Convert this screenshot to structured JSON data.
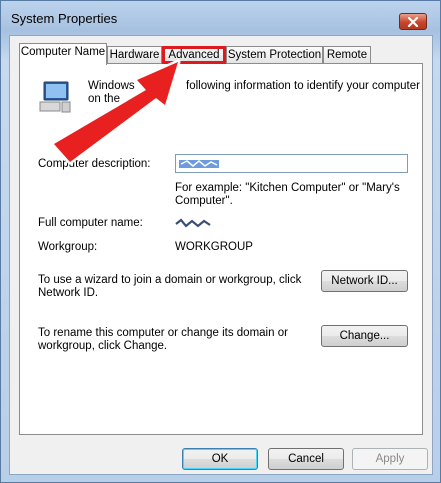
{
  "window": {
    "title": "System Properties"
  },
  "tabs": [
    {
      "label": "Computer Name",
      "active": true
    },
    {
      "label": "Hardware"
    },
    {
      "label": "Advanced",
      "highlighted": true
    },
    {
      "label": "System Protection"
    },
    {
      "label": "Remote"
    }
  ],
  "computer_name": {
    "intro_line1": "Windows",
    "intro_line1_tail": "following information to identify your computer",
    "intro_line2": "on the",
    "description_label": "Computer description:",
    "description_value": "",
    "example_line1": "For example: \"Kitchen Computer\" or \"Mary's",
    "example_line2": "Computer\".",
    "full_name_label": "Full computer name:",
    "full_name_value": "",
    "workgroup_label": "Workgroup:",
    "workgroup_value": "WORKGROUP",
    "network_text_line1": "To use a wizard to join a domain or workgroup, click",
    "network_text_line2": "Network ID.",
    "network_button": "Network ID...",
    "rename_text_line1": "To rename this computer or change its domain or",
    "rename_text_line2": "workgroup, click Change.",
    "change_button": "Change..."
  },
  "footer": {
    "ok_button": "OK",
    "cancel_button": "Cancel",
    "apply_button": "Apply"
  },
  "colors": {
    "highlight": "#e0191f",
    "arrow": "#e8201f"
  }
}
